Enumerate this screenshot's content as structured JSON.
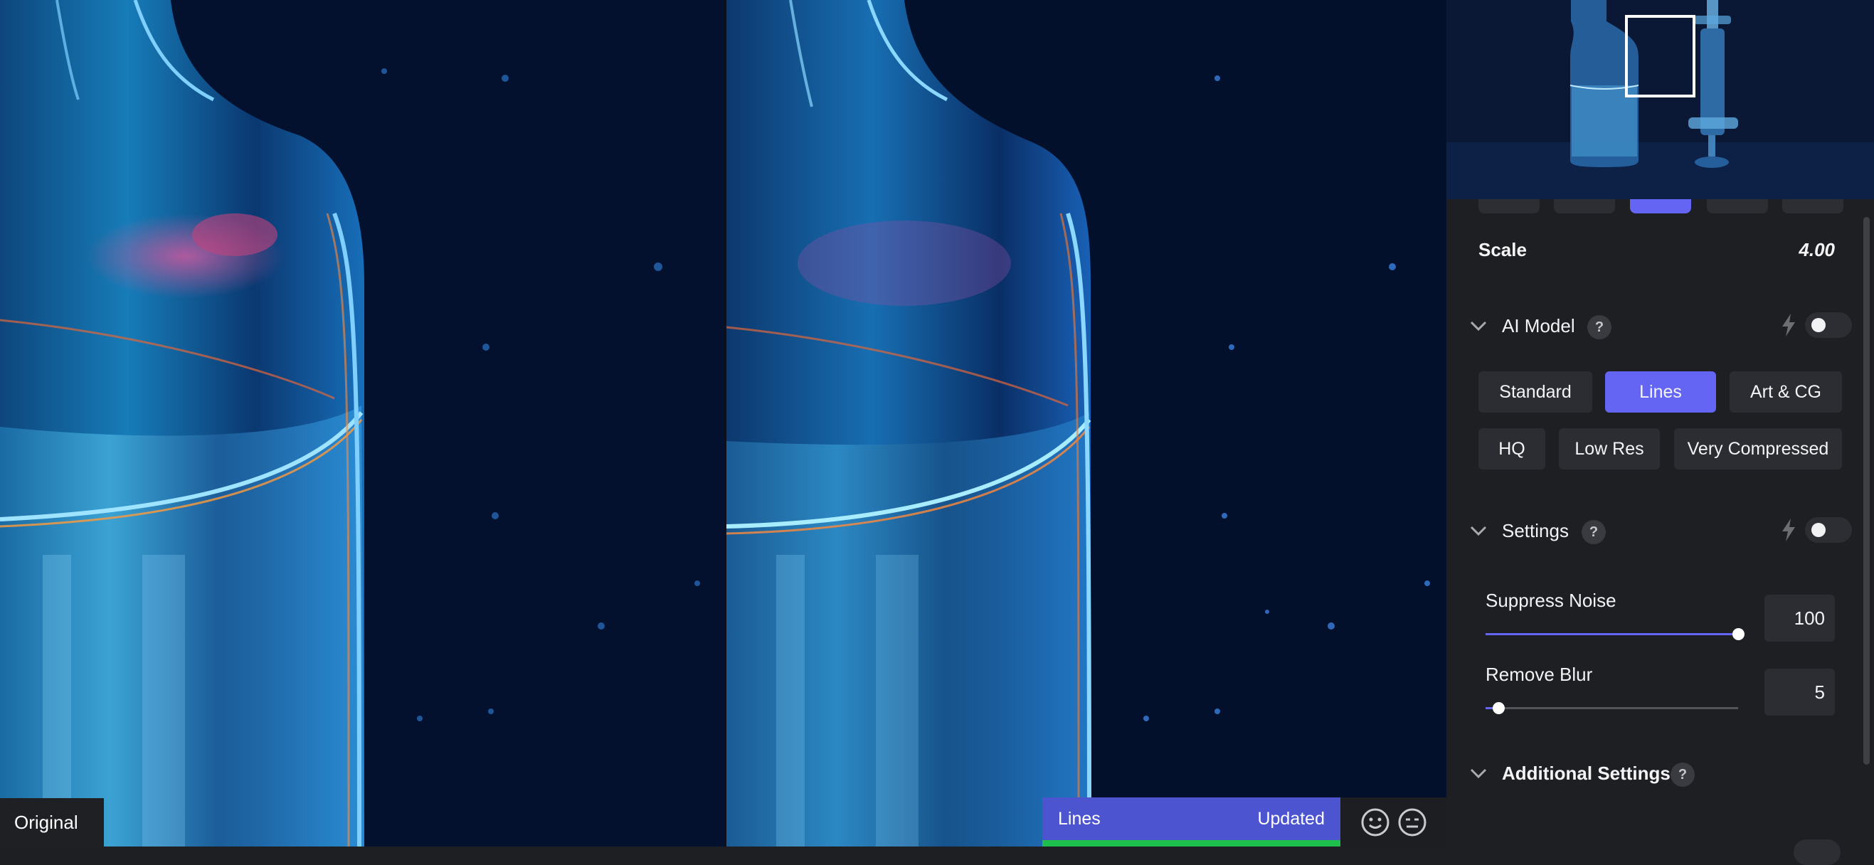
{
  "preview": {
    "left_label": "Original",
    "status": {
      "model": "Lines",
      "state": "Updated"
    }
  },
  "panel": {
    "scale": {
      "label": "Scale",
      "value": "4.00"
    },
    "ai_model": {
      "title": "AI Model",
      "help": "?",
      "buttons": [
        "Standard",
        "Lines",
        "Art & CG",
        "HQ",
        "Low Res",
        "Very Compressed"
      ],
      "selected": "Lines"
    },
    "settings": {
      "title": "Settings",
      "help": "?",
      "suppress_noise": {
        "label": "Suppress Noise",
        "value": "100",
        "level": 1.0
      },
      "remove_blur": {
        "label": "Remove Blur",
        "value": "5",
        "level": 0.05
      }
    },
    "additional_settings": {
      "title": "Additional Settings",
      "help": "?"
    }
  },
  "colors": {
    "accent": "#6465f2",
    "status_bar": "#4c55cf",
    "progress": "#1fbf4e",
    "panel_bg": "#1e1f22",
    "button_bg": "#2c2d32"
  },
  "icons": [
    "chevron-down-icon",
    "help-icon",
    "bolt-icon",
    "toggle-switch",
    "smiley-icon",
    "neutral-face-icon"
  ]
}
